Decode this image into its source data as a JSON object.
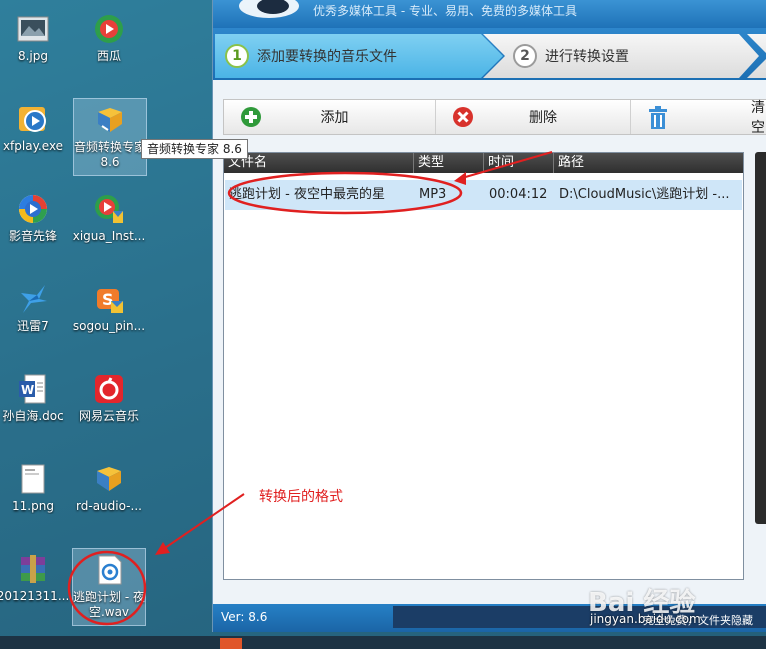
{
  "desktop": {
    "icons": [
      {
        "label": "8.jpg",
        "icon": "image-file-icon"
      },
      {
        "label": "西瓜",
        "icon": "xigua-icon"
      },
      {
        "label": "xfplay.exe",
        "icon": "xfplay-icon"
      },
      {
        "label": "音频转换专家 8.6",
        "icon": "audio-converter-icon"
      },
      {
        "label": "影音先锋",
        "icon": "player-icon"
      },
      {
        "label": "xigua_Inst...",
        "icon": "xigua-installer-icon"
      },
      {
        "label": "迅雷7",
        "icon": "thunder-icon"
      },
      {
        "label": "sogou_pin...",
        "icon": "sogou-icon"
      },
      {
        "label": "孙自海.doc",
        "icon": "word-doc-icon"
      },
      {
        "label": "网易云音乐",
        "icon": "netease-music-icon"
      },
      {
        "label": "11.png",
        "icon": "image-file-icon"
      },
      {
        "label": "rd-audio-...",
        "icon": "audio-converter-icon"
      },
      {
        "label": "20121311...",
        "icon": "winrar-icon"
      },
      {
        "label": "逃跑计划 - 夜空.wav",
        "icon": "audio-file-icon"
      }
    ],
    "tooltip": "音频转换专家 8.6"
  },
  "annotation": {
    "text": "转换后的格式"
  },
  "app": {
    "slogan": "优秀多媒体工具 - 专业、易用、免费的多媒体工具",
    "steps": [
      {
        "num": "1",
        "label": "添加要转换的音乐文件"
      },
      {
        "num": "2",
        "label": "进行转换设置"
      }
    ],
    "toolbar": {
      "add": "添加",
      "delete": "删除",
      "clear": "清空"
    },
    "table": {
      "headers": [
        "文件名",
        "类型",
        "时间",
        "路径"
      ],
      "rows": [
        {
          "name": "逃跑计划 - 夜空中最亮的星",
          "type": "MP3",
          "time": "00:04:12",
          "path": "D:\\CloudMusic\\逃跑计划 -..."
        }
      ]
    },
    "status": {
      "version": "Ver: 8.6",
      "text": "完全免费，文件夹隐藏"
    }
  },
  "watermark": {
    "brand": "Bai 经验",
    "url": "jingyan.baidu.com"
  },
  "colors": {
    "accent_blue": "#1f72b8",
    "annotation_red": "#e02020",
    "selected_row": "#cfe6f8"
  }
}
